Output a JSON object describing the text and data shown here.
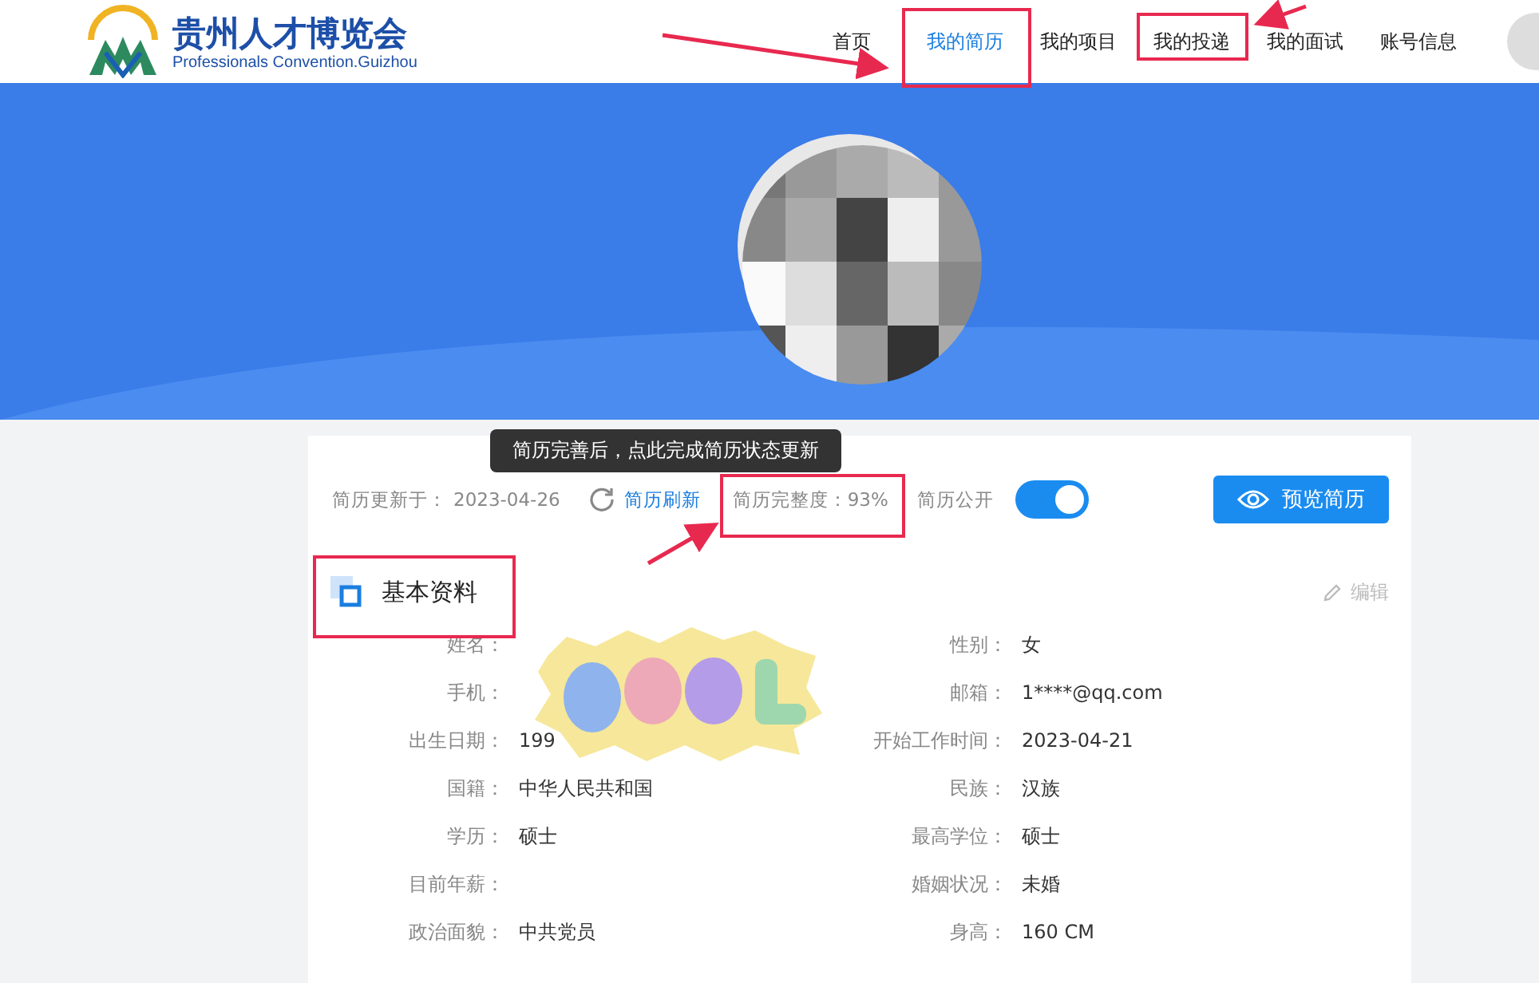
{
  "header": {
    "title": "贵州人才博览会",
    "subtitle": "Professionals Convention.Guizhou",
    "nav": [
      {
        "label": "首页",
        "selected": false
      },
      {
        "label": "我的简历",
        "selected": true
      },
      {
        "label": "我的项目",
        "selected": false
      },
      {
        "label": "我的投递",
        "selected": false
      },
      {
        "label": "我的面试",
        "selected": false
      },
      {
        "label": "账号信息",
        "selected": false
      }
    ]
  },
  "toolbar": {
    "updated_label": "简历更新于：",
    "updated_date": "2023-04-26",
    "refresh": "简历刷新",
    "tooltip": "简历完善后，点此完成简历状态更新",
    "completeness": "简历完整度：93%",
    "public_label": "简历公开",
    "public_on": true,
    "preview_button": "预览简历"
  },
  "section": {
    "title": "基本资料",
    "edit": "编辑"
  },
  "fields": [
    {
      "label": "姓名：",
      "right_label": "性别：",
      "right_value": "女"
    },
    {
      "label": "手机：",
      "right_label": "邮箱：",
      "right_value": "1****@qq.com"
    },
    {
      "label": "出生日期：",
      "value": "199",
      "right_label": "开始工作时间：",
      "right_value": "2023-04-21"
    },
    {
      "label": "国籍：",
      "value": "中华人民共和国",
      "right_label": "民族：",
      "right_value": "汉族"
    },
    {
      "label": "学历：",
      "value": "硕士",
      "right_label": "最高学位：",
      "right_value": "硕士"
    },
    {
      "label": "目前年薪：",
      "right_label": "婚姻状况：",
      "right_value": "未婚"
    },
    {
      "label": "政治面貌：",
      "value": "中共党员",
      "right_label": "身高：",
      "right_value": "160 CM"
    }
  ]
}
